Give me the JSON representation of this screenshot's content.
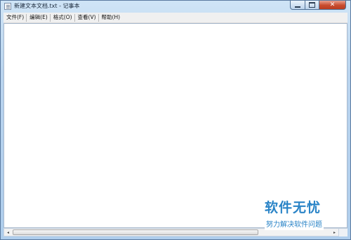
{
  "window": {
    "title": "新建文本文档.txt - 记事本",
    "controls": {
      "minimize": "minimize",
      "maximize": "maximize",
      "close": "✕"
    }
  },
  "menu": {
    "items": [
      {
        "label": "文件(F)"
      },
      {
        "label": "编辑(E)"
      },
      {
        "label": "格式(O)"
      },
      {
        "label": "查看(V)"
      },
      {
        "label": "帮助(H)"
      }
    ]
  },
  "editor": {
    "content": ""
  },
  "scrollbar": {
    "left_arrow": "◂",
    "right_arrow": "▸"
  },
  "watermark": {
    "title": "软件无忧",
    "subtitle": "努力解决软件问题"
  },
  "colors": {
    "accent": "#2a84c7",
    "close_button": "#c84b2e",
    "frame": "#b9d4ee"
  }
}
